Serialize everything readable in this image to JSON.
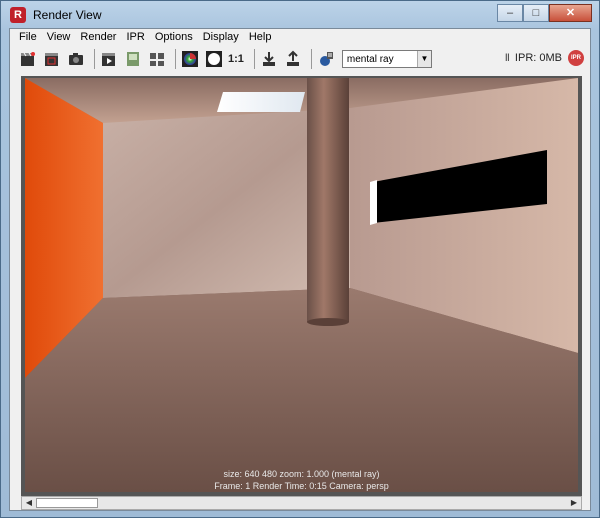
{
  "window": {
    "title": "Render View",
    "app_icon": "render-view-logo",
    "controls": {
      "minimize": "–",
      "maximize": "□",
      "close": "✕"
    }
  },
  "menu": {
    "items": [
      "File",
      "View",
      "Render",
      "IPR",
      "Options",
      "Display",
      "Help"
    ]
  },
  "toolbar": {
    "buttons": [
      "render-frame-icon",
      "render-region-icon",
      "snapshot-icon",
      "render-sequence-icon",
      "keep-image-icon",
      "remove-image-icon",
      "color-channels-icon",
      "alpha-channel-icon"
    ],
    "ratio_label": "1:1",
    "renderer": {
      "selected": "mental ray"
    },
    "ipr": {
      "pause": "II",
      "memory": "IPR: 0MB",
      "badge": "IPR"
    }
  },
  "status": {
    "line1": "size:  640  480 zoom: 1.000       (mental ray)",
    "line2": "Frame: 1      Render Time: 0:15      Camera: persp"
  },
  "colors": {
    "accent_orange": "#e0520f",
    "wall": "#c9a89a",
    "floor": "#8a6a5e"
  }
}
